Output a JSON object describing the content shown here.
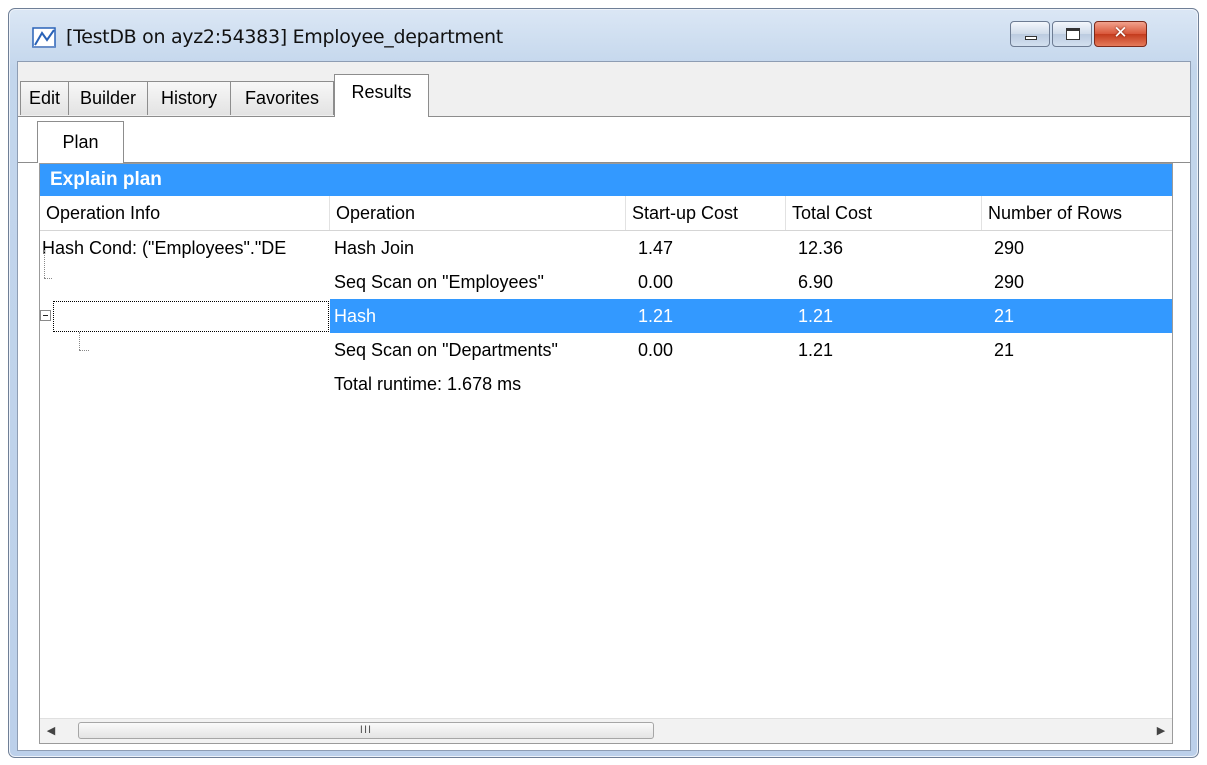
{
  "window": {
    "title": "[TestDB on ayz2:54383] Employee_department",
    "close_glyph": "✕"
  },
  "tabs": [
    {
      "label": "Edit"
    },
    {
      "label": "Builder"
    },
    {
      "label": "History"
    },
    {
      "label": "Favorites"
    },
    {
      "label": "Results"
    }
  ],
  "active_tab": "Results",
  "subtabs": [
    {
      "label": "Plan"
    }
  ],
  "panel": {
    "title": "Explain plan",
    "columns": [
      "Operation Info",
      "Operation",
      "Start-up Cost",
      "Total Cost",
      "Number of Rows"
    ],
    "rows": [
      {
        "info": "Hash Cond: (\"Employees\".\"DE",
        "operation": "Hash Join",
        "startup": "1.47",
        "total": "12.36",
        "rows": "290"
      },
      {
        "info": "",
        "operation": "Seq Scan on \"Employees\"",
        "startup": "0.00",
        "total": "6.90",
        "rows": "290"
      },
      {
        "info": "",
        "operation": "Hash",
        "startup": "1.21",
        "total": "1.21",
        "rows": "21"
      },
      {
        "info": "",
        "operation": "Seq Scan on \"Departments\"",
        "startup": "0.00",
        "total": "1.21",
        "rows": "21"
      },
      {
        "info": "",
        "operation": "Total runtime: 1.678 ms",
        "startup": "",
        "total": "",
        "rows": ""
      }
    ],
    "selected_row": 2
  },
  "scrollbar": {
    "left_arrow": "◀",
    "right_arrow": "▶",
    "thumb_grip": "III"
  },
  "colors": {
    "selection": "#3399ff",
    "header_bar": "#3399ff"
  }
}
